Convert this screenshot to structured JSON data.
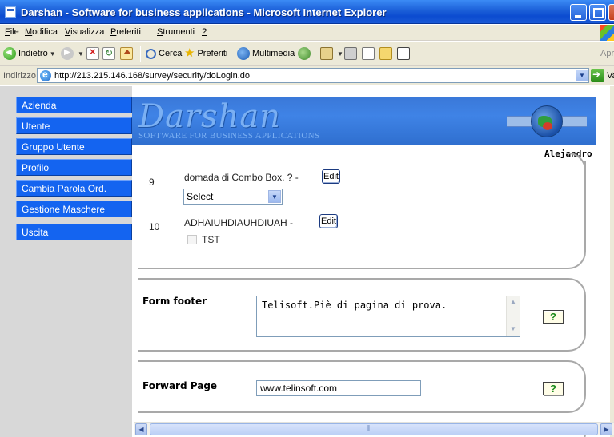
{
  "window": {
    "title": "Darshan - Software for business applications - Microsoft Internet Explorer"
  },
  "menubar": {
    "items": [
      {
        "label": "File",
        "u": "F",
        "rest": "ile"
      },
      {
        "label": "Modifica",
        "u": "M",
        "rest": "odifica"
      },
      {
        "label": "Visualizza",
        "u": "V",
        "rest": "isualizza"
      },
      {
        "label": "Preferiti",
        "u": "P",
        "rest": "referiti"
      },
      {
        "label": "Strumenti",
        "u": "S",
        "rest": "trumenti"
      },
      {
        "label": "?",
        "u": "?",
        "rest": ""
      }
    ]
  },
  "toolbar": {
    "back_label": "Indietro",
    "search_label": "Cerca",
    "favorites_label": "Preferiti",
    "media_label": "Multimedia",
    "right_label": "Apr"
  },
  "addressbar": {
    "label": "Indirizzo",
    "url": "http://213.215.146.168/survey/security/doLogin.do",
    "go_label": "Vai"
  },
  "sidebar": {
    "items": [
      {
        "label": "Azienda"
      },
      {
        "label": "Utente"
      },
      {
        "label": "Gruppo Utente"
      },
      {
        "label": "Profilo"
      },
      {
        "label": "Cambia Parola Ord."
      },
      {
        "label": "Gestione Maschere"
      },
      {
        "label": "Uscita"
      }
    ]
  },
  "banner": {
    "logo": "Darshan",
    "tagline": "SOFTWARE FOR BUSINESS APPLICATIONS"
  },
  "user": {
    "name": "Alejandro"
  },
  "questions": [
    {
      "number": "9",
      "text": "domada di Combo Box. ? -",
      "edit_label": "Edit",
      "select_value": "Select"
    },
    {
      "number": "10",
      "text": "ADHAIUHDIAUHDIUAH -",
      "edit_label": "Edit",
      "checkbox_label": "TST",
      "checked": false
    }
  ],
  "form_footer": {
    "label": "Form footer",
    "value": "Telisoft.Piè di pagina di prova.",
    "help_label": "?"
  },
  "forward_page": {
    "label": "Forward Page",
    "value": "www.telinsoft.com",
    "help_label": "?"
  },
  "colors": {
    "nav_blue": "#1464f0",
    "banner_blue": "#3a78d8",
    "sidebar_gray": "#d8d8d8",
    "titlebar_blue": "#0b4bd0"
  }
}
